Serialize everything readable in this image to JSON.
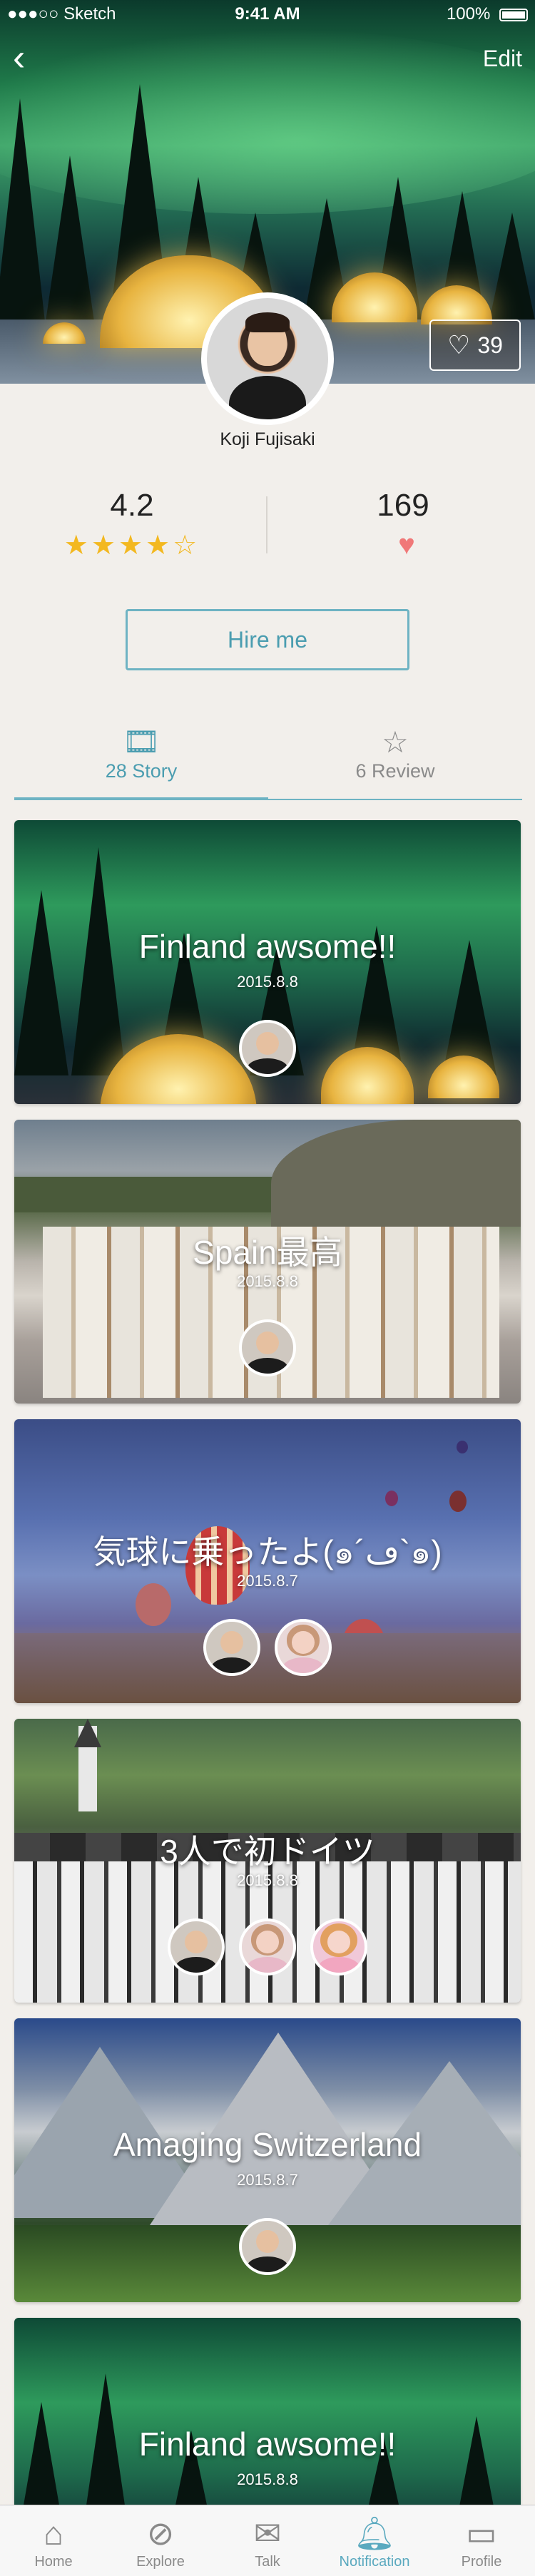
{
  "status": {
    "carrier": "●●●○○ Sketch",
    "time": "9:41 AM",
    "battery": "100%"
  },
  "nav": {
    "back_icon": "‹",
    "edit_label": "Edit"
  },
  "profile": {
    "name": "Koji Fujisaki",
    "likes": "39"
  },
  "stats": {
    "rating": "4.2",
    "rating_stars": 4,
    "rating_max": 5,
    "hearts": "169"
  },
  "hire_label": "Hire me",
  "tabs": [
    {
      "label": "28 Story",
      "icon": "film-icon",
      "active": true
    },
    {
      "label": "6 Review",
      "icon": "star-icon",
      "active": false
    }
  ],
  "stories": [
    {
      "title": "Finland awsome!!",
      "date": "2015.8.8"
    },
    {
      "title": "Spain最高",
      "date": "2015.8.8"
    },
    {
      "title": "気球に乗ったよ(๑´ڡ`๑)",
      "date": "2015.8.7"
    },
    {
      "title": "3人で初ドイツ",
      "date": "2015.8.8"
    },
    {
      "title": "Amaging Switzerland",
      "date": "2015.8.7"
    },
    {
      "title": "Finland awsome!!",
      "date": "2015.8.8"
    }
  ],
  "tabbar": [
    {
      "label": "Home",
      "icon": "home-icon",
      "active": false
    },
    {
      "label": "Explore",
      "icon": "compass-icon",
      "active": false
    },
    {
      "label": "Talk",
      "icon": "mail-icon",
      "active": false
    },
    {
      "label": "Notification",
      "icon": "bell-icon",
      "active": true
    },
    {
      "label": "Profile",
      "icon": "id-card-icon",
      "active": false
    }
  ],
  "colors": {
    "accent": "#5aa9bf",
    "star": "#f3b820",
    "heart": "#f07878",
    "background": "#f2efeb"
  }
}
